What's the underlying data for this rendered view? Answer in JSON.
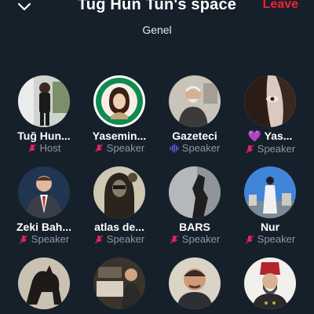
{
  "header": {
    "title": "Tug Hun Tun's space",
    "leave_label": "Leave",
    "subtitle": "Genel"
  },
  "colors": {
    "background": "#15202b",
    "leave": "#f4212e",
    "mic_off": "#e0245e",
    "speaking": "#5b5bd6",
    "secondary_text": "#8b98a5"
  },
  "participants": [
    {
      "name": "Tuğ Hun...",
      "role": "Host",
      "mic": "mic-off-icon"
    },
    {
      "name": "Yasemin...",
      "role": "Speaker",
      "mic": "mic-off-icon"
    },
    {
      "name": "Gazeteci",
      "role": "Speaker",
      "mic": "speaking-icon"
    },
    {
      "name": "💜 Yas...",
      "role": "Speaker",
      "mic": "mic-off-icon"
    },
    {
      "name": "Zeki Bah...",
      "role": "Speaker",
      "mic": "mic-off-icon"
    },
    {
      "name": "atlas de...",
      "role": "Speaker",
      "mic": "mic-off-icon"
    },
    {
      "name": "BARS",
      "role": "Speaker",
      "mic": "mic-off-icon"
    },
    {
      "name": "Nur",
      "role": "Speaker",
      "mic": "mic-off-icon"
    },
    {
      "name": "",
      "role": "",
      "mic": ""
    },
    {
      "name": "",
      "role": "",
      "mic": ""
    },
    {
      "name": "",
      "role": "",
      "mic": ""
    },
    {
      "name": "",
      "role": "",
      "mic": ""
    }
  ]
}
